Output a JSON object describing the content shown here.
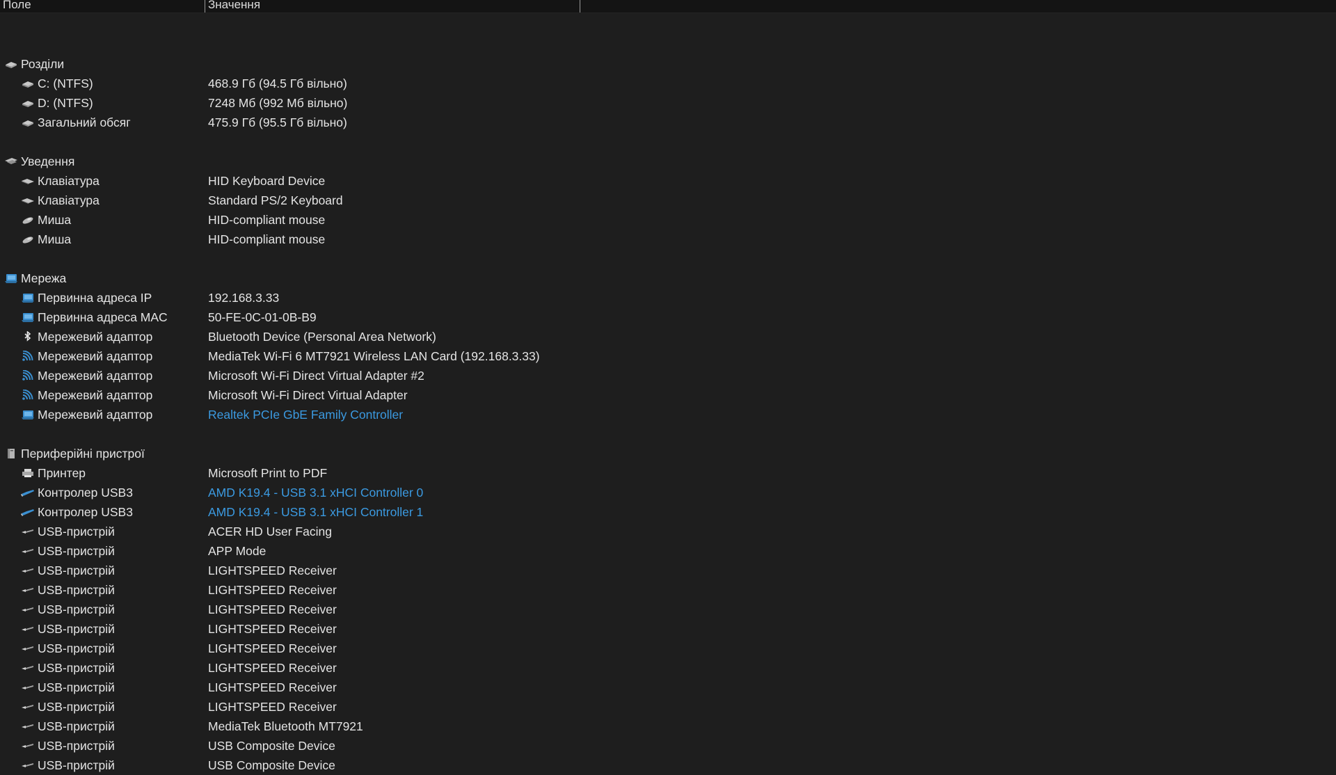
{
  "columns": {
    "field": "Поле",
    "value": "Значення"
  },
  "colors": {
    "background": "#1e1e1e",
    "text": "#e4e4e4",
    "link": "#3b9ae1"
  },
  "rows": [
    {
      "kind": "gap"
    },
    {
      "kind": "section",
      "icon": "drive-icon",
      "field": "Розділи"
    },
    {
      "kind": "item",
      "icon": "drive-icon",
      "field": "C: (NTFS)",
      "value": "468.9 Гб (94.5 Гб вільно)"
    },
    {
      "kind": "item",
      "icon": "drive-icon",
      "field": "D: (NTFS)",
      "value": "7248 Мб (992 Мб вільно)"
    },
    {
      "kind": "item",
      "icon": "drive-icon",
      "field": "Загальний обсяг",
      "value": "475.9 Гб (95.5 Гб вільно)"
    },
    {
      "kind": "gap"
    },
    {
      "kind": "section",
      "icon": "input-icon",
      "field": "Уведення"
    },
    {
      "kind": "item",
      "icon": "keyboard-icon",
      "field": "Клавіатура",
      "value": "HID Keyboard Device"
    },
    {
      "kind": "item",
      "icon": "keyboard-icon",
      "field": "Клавіатура",
      "value": "Standard PS/2 Keyboard"
    },
    {
      "kind": "item",
      "icon": "mouse-icon",
      "field": "Миша",
      "value": "HID-compliant mouse"
    },
    {
      "kind": "item",
      "icon": "mouse-icon",
      "field": "Миша",
      "value": "HID-compliant mouse"
    },
    {
      "kind": "gap"
    },
    {
      "kind": "section",
      "icon": "network-icon",
      "field": "Мережа"
    },
    {
      "kind": "item",
      "icon": "network-icon",
      "field": "Первинна адреса IP",
      "value": "192.168.3.33"
    },
    {
      "kind": "item",
      "icon": "network-icon",
      "field": "Первинна адреса MAC",
      "value": "50-FE-0C-01-0B-B9"
    },
    {
      "kind": "item",
      "icon": "bluetooth-icon",
      "field": "Мережевий адаптор",
      "value": "Bluetooth Device (Personal Area Network)"
    },
    {
      "kind": "item",
      "icon": "wifi-icon",
      "field": "Мережевий адаптор",
      "value": "MediaTek Wi-Fi 6 MT7921 Wireless LAN Card  (192.168.3.33)"
    },
    {
      "kind": "item",
      "icon": "wifi-icon",
      "field": "Мережевий адаптор",
      "value": "Microsoft Wi-Fi Direct Virtual Adapter #2"
    },
    {
      "kind": "item",
      "icon": "wifi-icon",
      "field": "Мережевий адаптор",
      "value": "Microsoft Wi-Fi Direct Virtual Adapter"
    },
    {
      "kind": "item",
      "icon": "network-icon",
      "field": "Мережевий адаптор",
      "value": "Realtek PCIe GbE Family Controller",
      "link": true
    },
    {
      "kind": "gap"
    },
    {
      "kind": "section",
      "icon": "peripherals-icon",
      "field": "Периферійні пристрої"
    },
    {
      "kind": "item",
      "icon": "printer-icon",
      "field": "Принтер",
      "value": "Microsoft Print to PDF"
    },
    {
      "kind": "item",
      "icon": "usb-controller-icon",
      "field": "Контролер USB3",
      "value": "AMD K19.4 - USB 3.1 xHCI Controller 0",
      "link": true
    },
    {
      "kind": "item",
      "icon": "usb-controller-icon",
      "field": "Контролер USB3",
      "value": "AMD K19.4 - USB 3.1 xHCI Controller 1",
      "link": true
    },
    {
      "kind": "item",
      "icon": "usb-icon",
      "field": "USB-пристрій",
      "value": "ACER HD User Facing"
    },
    {
      "kind": "item",
      "icon": "usb-icon",
      "field": "USB-пристрій",
      "value": "APP Mode"
    },
    {
      "kind": "item",
      "icon": "usb-icon",
      "field": "USB-пристрій",
      "value": "LIGHTSPEED Receiver"
    },
    {
      "kind": "item",
      "icon": "usb-icon",
      "field": "USB-пристрій",
      "value": "LIGHTSPEED Receiver"
    },
    {
      "kind": "item",
      "icon": "usb-icon",
      "field": "USB-пристрій",
      "value": "LIGHTSPEED Receiver"
    },
    {
      "kind": "item",
      "icon": "usb-icon",
      "field": "USB-пристрій",
      "value": "LIGHTSPEED Receiver"
    },
    {
      "kind": "item",
      "icon": "usb-icon",
      "field": "USB-пристрій",
      "value": "LIGHTSPEED Receiver"
    },
    {
      "kind": "item",
      "icon": "usb-icon",
      "field": "USB-пристрій",
      "value": "LIGHTSPEED Receiver"
    },
    {
      "kind": "item",
      "icon": "usb-icon",
      "field": "USB-пристрій",
      "value": "LIGHTSPEED Receiver"
    },
    {
      "kind": "item",
      "icon": "usb-icon",
      "field": "USB-пристрій",
      "value": "LIGHTSPEED Receiver"
    },
    {
      "kind": "item",
      "icon": "usb-icon",
      "field": "USB-пристрій",
      "value": "MediaTek Bluetooth MT7921"
    },
    {
      "kind": "item",
      "icon": "usb-icon",
      "field": "USB-пристрій",
      "value": "USB Composite Device"
    },
    {
      "kind": "item",
      "icon": "usb-icon",
      "field": "USB-пристрій",
      "value": "USB Composite Device"
    }
  ]
}
